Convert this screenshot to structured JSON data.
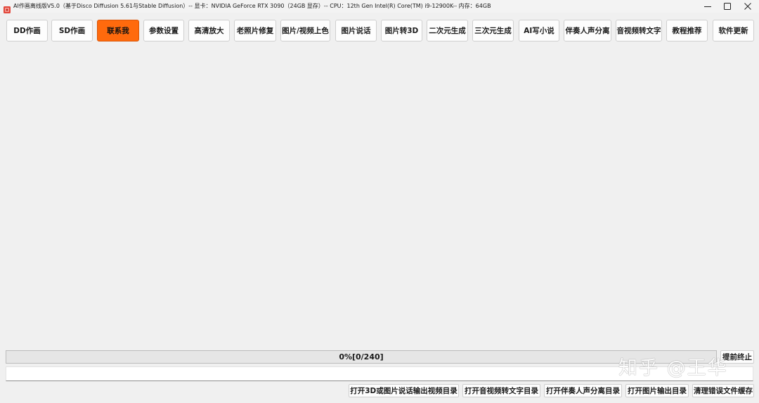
{
  "window": {
    "title": "AI作画离线版V5.0（基于Disco Diffusion 5.61与Stable Diffusion）-- 显卡：NVIDIA GeForce RTX 3090（24GB 显存）-- CPU：12th Gen Intel(R) Core(TM) i9-12900K-- 内存：64GB",
    "icon": "app-icon",
    "controls": [
      "minimize-icon",
      "maximize-icon",
      "close-icon"
    ]
  },
  "toolbar": {
    "buttons": [
      {
        "label": "DD作画"
      },
      {
        "label": "SD作画"
      },
      {
        "label": "联系我",
        "active": true
      },
      {
        "label": "参数设置"
      },
      {
        "label": "高清放大"
      },
      {
        "label": "老照片修复"
      },
      {
        "label": "图片/视频上色"
      },
      {
        "label": "图片说话"
      },
      {
        "label": "图片转3D"
      },
      {
        "label": "二次元生成"
      },
      {
        "label": "三次元生成"
      },
      {
        "label": "AI写小说"
      },
      {
        "label": "伴奏人声分离"
      },
      {
        "label": "音视频转文字"
      },
      {
        "label": "教程推荐"
      },
      {
        "label": "软件更新"
      }
    ]
  },
  "progress": {
    "label": "0%[0/240]",
    "percent": 0
  },
  "stop_button": {
    "label": "提前终止"
  },
  "status_field": {
    "value": ""
  },
  "bottom_buttons": [
    {
      "label": "打开3D或图片说话输出视频目录"
    },
    {
      "label": "打开音视频转文字目录"
    },
    {
      "label": "打开伴奏人声分离目录"
    },
    {
      "label": "打开图片输出目录"
    },
    {
      "label": "清理错误文件缓存"
    }
  ],
  "watermark": "知乎 @王华",
  "colors": {
    "window_bg": "#f0f0f0",
    "accent": "#ff6a0d",
    "button_bg": "#fdfdfd",
    "progress_track": "#e6e6e6"
  }
}
